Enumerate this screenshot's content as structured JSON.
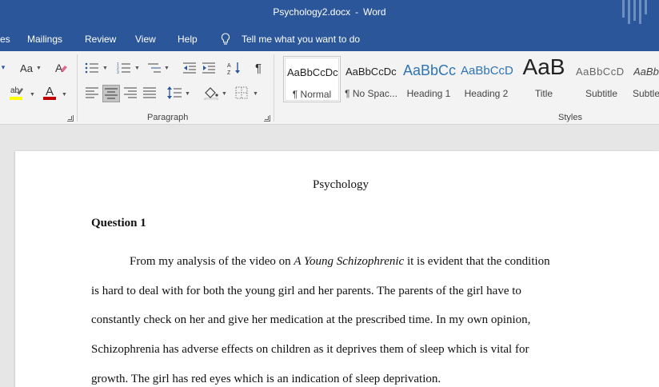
{
  "window": {
    "filename": "Psychology2.docx",
    "separator": "-",
    "app": "Word"
  },
  "menu": {
    "tabs": [
      "es",
      "Mailings",
      "Review",
      "View",
      "Help"
    ],
    "tell_me": "Tell me what you want to do"
  },
  "ribbon": {
    "font_group": {
      "font_size_btn": "Aa",
      "clear_format_btn": "A",
      "highlight_btn": "ab",
      "font_color_btn": "A",
      "font_color": "#c00000",
      "highlight_color": "#ffff00"
    },
    "paragraph_group": {
      "label": "Paragraph",
      "pilcrow": "¶"
    },
    "styles_group": {
      "label": "Styles",
      "items": [
        {
          "sample": "AaBbCcDc",
          "name": "¶ Normal",
          "active": true
        },
        {
          "sample": "AaBbCcDc",
          "name": "¶ No Spac...",
          "active": false
        },
        {
          "sample": "AaBbCc",
          "name": "Heading 1",
          "active": false
        },
        {
          "sample": "AaBbCcD",
          "name": "Heading 2",
          "active": false
        },
        {
          "sample": "AaB",
          "name": "Title",
          "active": false
        },
        {
          "sample": "AaBbCcD",
          "name": "Subtitle",
          "active": false
        },
        {
          "sample": "AaBbC",
          "name": "Subtle",
          "active": false
        }
      ]
    }
  },
  "document": {
    "title": "Psychology",
    "heading": "Question 1",
    "paragraph_lines": [
      {
        "before": "From my analysis of the video on ",
        "italic": "A Young Schizophrenic",
        "after": " it is evident that the condition"
      },
      {
        "before": "is hard to deal with for both the young girl and her parents. The parents of the girl have to",
        "italic": "",
        "after": ""
      },
      {
        "before": "constantly check on her and give her medication at the prescribed time. In my own opinion,",
        "italic": "",
        "after": ""
      },
      {
        "before": "Schizophrenia has adverse effects on children as it deprives them of sleep which is vital for",
        "italic": "",
        "after": ""
      },
      {
        "before": "growth. The girl has red eyes which is an indication of sleep deprivation.",
        "italic": "",
        "after": ""
      }
    ]
  },
  "colors": {
    "word_blue": "#2b579a",
    "heading_blue": "#2e74b5"
  }
}
